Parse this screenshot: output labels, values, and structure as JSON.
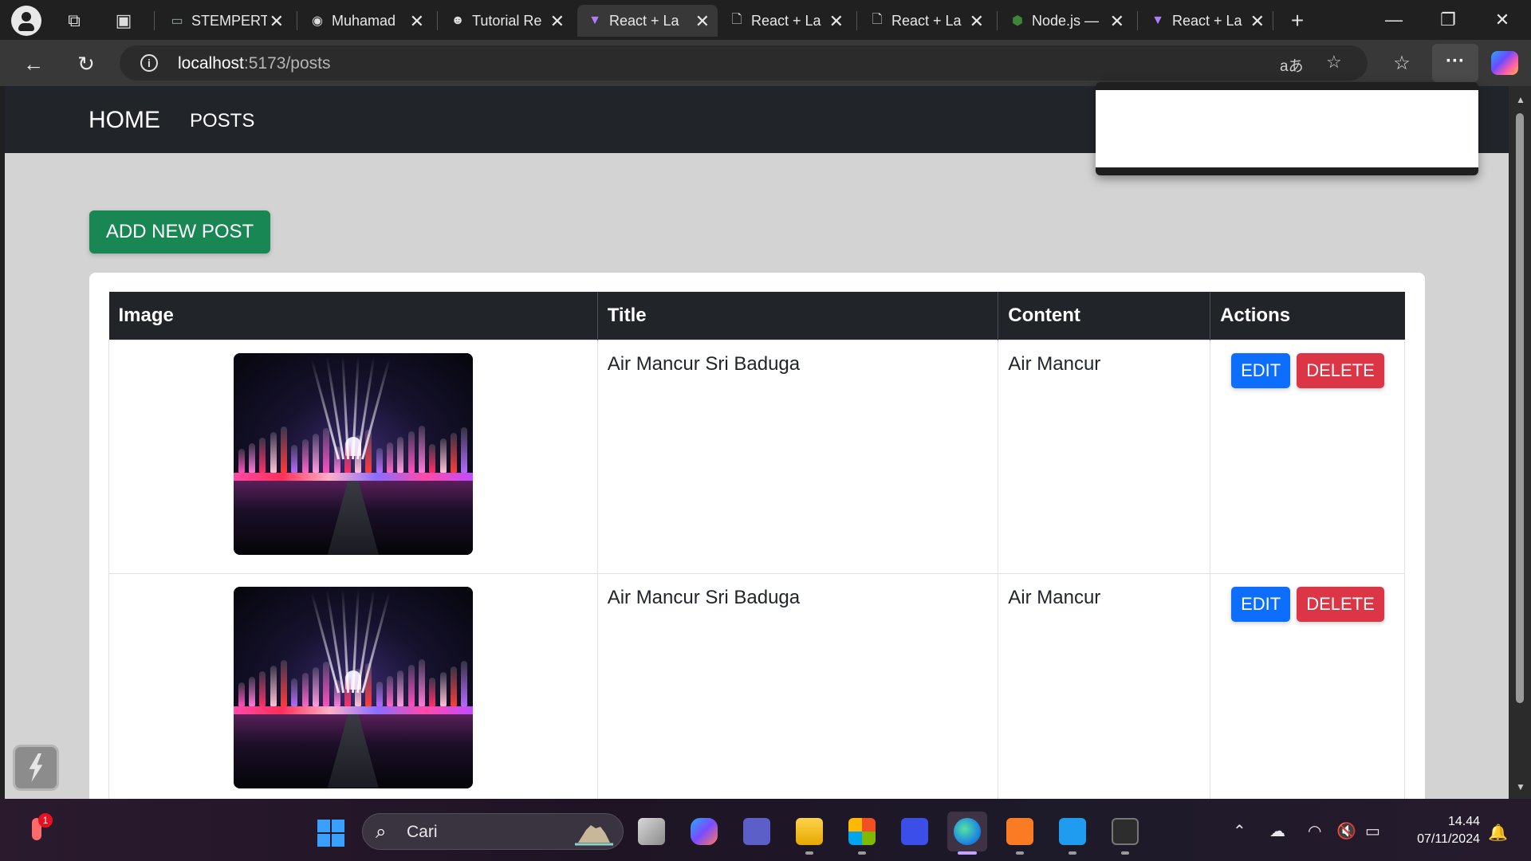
{
  "browser": {
    "tabs": [
      {
        "title": "STEMPERT",
        "favicon": "card-icon",
        "active": false
      },
      {
        "title": "Muhamad",
        "favicon": "github-icon",
        "active": false
      },
      {
        "title": "Tutorial Re",
        "favicon": "skull-icon",
        "active": false
      },
      {
        "title": "React + La",
        "favicon": "vite-icon",
        "active": true
      },
      {
        "title": "React + La",
        "favicon": "file-icon",
        "active": false
      },
      {
        "title": "React + La",
        "favicon": "file-icon",
        "active": false
      },
      {
        "title": "Node.js —",
        "favicon": "node-icon",
        "active": false
      },
      {
        "title": "React + La",
        "favicon": "vite-icon",
        "active": false
      }
    ],
    "url_host": "localhost",
    "url_rest": ":5173/posts",
    "translate_glyph": "aあ"
  },
  "navbar": {
    "home": "HOME",
    "posts": "POSTS"
  },
  "page": {
    "add_button": "ADD NEW POST",
    "table": {
      "headers": [
        "Image",
        "Title",
        "Content",
        "Actions"
      ],
      "rows": [
        {
          "title": "Air Mancur Sri Baduga",
          "content": "Air Mancur",
          "image": "fountain-night-photo"
        },
        {
          "title": "Air Mancur Sri Baduga",
          "content": "Air Mancur",
          "image": "fountain-night-photo"
        }
      ],
      "edit_label": "EDIT",
      "delete_label": "DELETE"
    }
  },
  "taskbar": {
    "search_label": "Cari",
    "time": "14.44",
    "date": "07/11/2024",
    "weather_badge": "1"
  },
  "colors": {
    "navbar_bg": "#212529",
    "page_bg": "#d3d3d3",
    "add_button": "#198754",
    "edit_button": "#0d6efd",
    "delete_button": "#dc3545"
  }
}
